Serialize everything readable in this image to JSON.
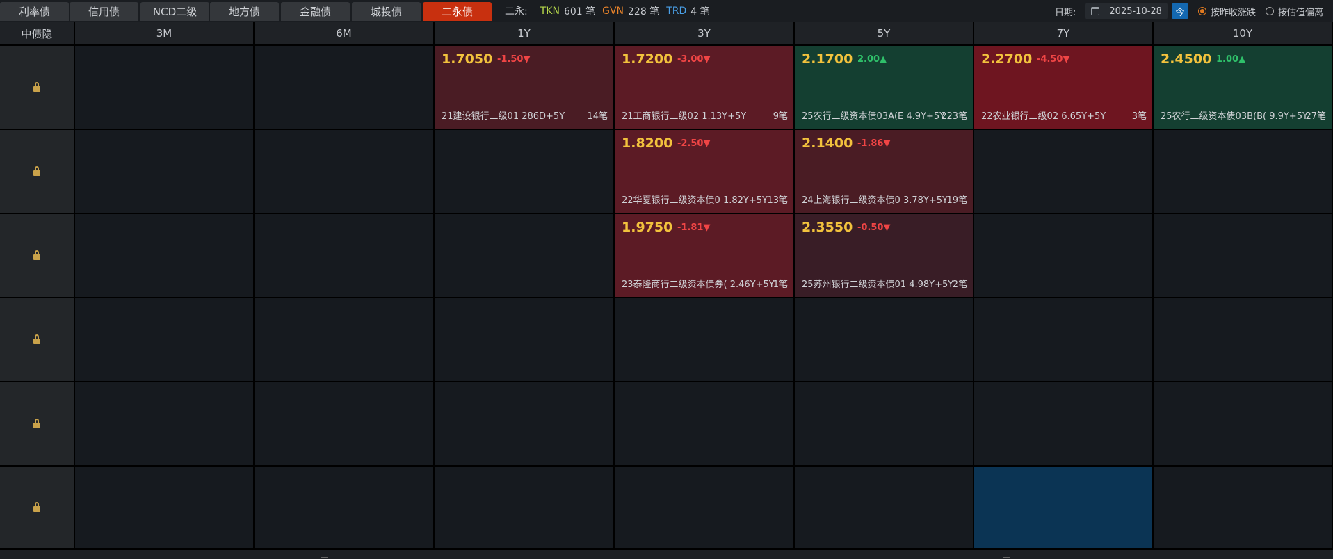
{
  "tabs": [
    {
      "label": "利率债"
    },
    {
      "label": "信用债"
    },
    {
      "label": "NCD二级"
    },
    {
      "label": "地方债"
    },
    {
      "label": "金融债"
    },
    {
      "label": "城投债"
    },
    {
      "label": "二永债",
      "active": true
    }
  ],
  "stats": {
    "prefix": "二永:",
    "tkn_label": "TKN",
    "tkn_count": "601 笔",
    "gvn_label": "GVN",
    "gvn_count": "228 笔",
    "trd_label": "TRD",
    "trd_count": "4 笔"
  },
  "date": {
    "label": "日期:",
    "value": "2025-10-28",
    "today_label": "今"
  },
  "radios": [
    {
      "label": "按昨收涨跌",
      "selected": true
    },
    {
      "label": "按估值偏离",
      "selected": false
    }
  ],
  "grid": {
    "corner": "中债隐",
    "columns": [
      "3M",
      "6M",
      "1Y",
      "3Y",
      "5Y",
      "7Y",
      "10Y"
    ],
    "cells": [
      {
        "row": 0,
        "col": 2,
        "price": "1.7050",
        "change": "-1.50▼",
        "dir": "down",
        "bond": "21建设银行二级01 286D+5Y",
        "count": "14笔",
        "tone": "red1"
      },
      {
        "row": 0,
        "col": 3,
        "price": "1.7200",
        "change": "-3.00▼",
        "dir": "down",
        "bond": "21工商银行二级02 1.13Y+5Y",
        "count": "9笔",
        "tone": "red2"
      },
      {
        "row": 0,
        "col": 4,
        "price": "2.1700",
        "change": "2.00▲",
        "dir": "up",
        "bond": "25农行二级资本债03A(E 4.9Y+5Y",
        "count": "223笔",
        "tone": "green"
      },
      {
        "row": 0,
        "col": 5,
        "price": "2.2700",
        "change": "-4.50▼",
        "dir": "down",
        "bond": "22农业银行二级02 6.65Y+5Y",
        "count": "3笔",
        "tone": "red3"
      },
      {
        "row": 0,
        "col": 6,
        "price": "2.4500",
        "change": "1.00▲",
        "dir": "up",
        "bond": "25农行二级资本债03B(B( 9.9Y+5Y",
        "count": "27笔",
        "tone": "green"
      },
      {
        "row": 1,
        "col": 3,
        "price": "1.8200",
        "change": "-2.50▼",
        "dir": "down",
        "bond": "22华夏银行二级资本债0 1.82Y+5Y",
        "count": "13笔",
        "tone": "red2"
      },
      {
        "row": 1,
        "col": 4,
        "price": "2.1400",
        "change": "-1.86▼",
        "dir": "down",
        "bond": "24上海银行二级资本债0 3.78Y+5Y",
        "count": "19笔",
        "tone": "red1"
      },
      {
        "row": 2,
        "col": 3,
        "price": "1.9750",
        "change": "-1.81▼",
        "dir": "down",
        "bond": "23泰隆商行二级资本债券( 2.46Y+5Y",
        "count": "1笔",
        "tone": "red2"
      },
      {
        "row": 2,
        "col": 4,
        "price": "2.3550",
        "change": "-0.50▼",
        "dir": "down",
        "bond": "25苏州银行二级资本债01 4.98Y+5Y",
        "count": "2笔",
        "tone": "red4"
      },
      {
        "row": 5,
        "col": 5,
        "tone": "blue"
      }
    ]
  },
  "colors": {
    "active_tab": "#c8300f",
    "price": "#f2c23d",
    "down": "#f04545",
    "up": "#2fc06a",
    "tkn": "#b6d84a",
    "gvn": "#e8832a",
    "trd": "#4aa0e8"
  }
}
